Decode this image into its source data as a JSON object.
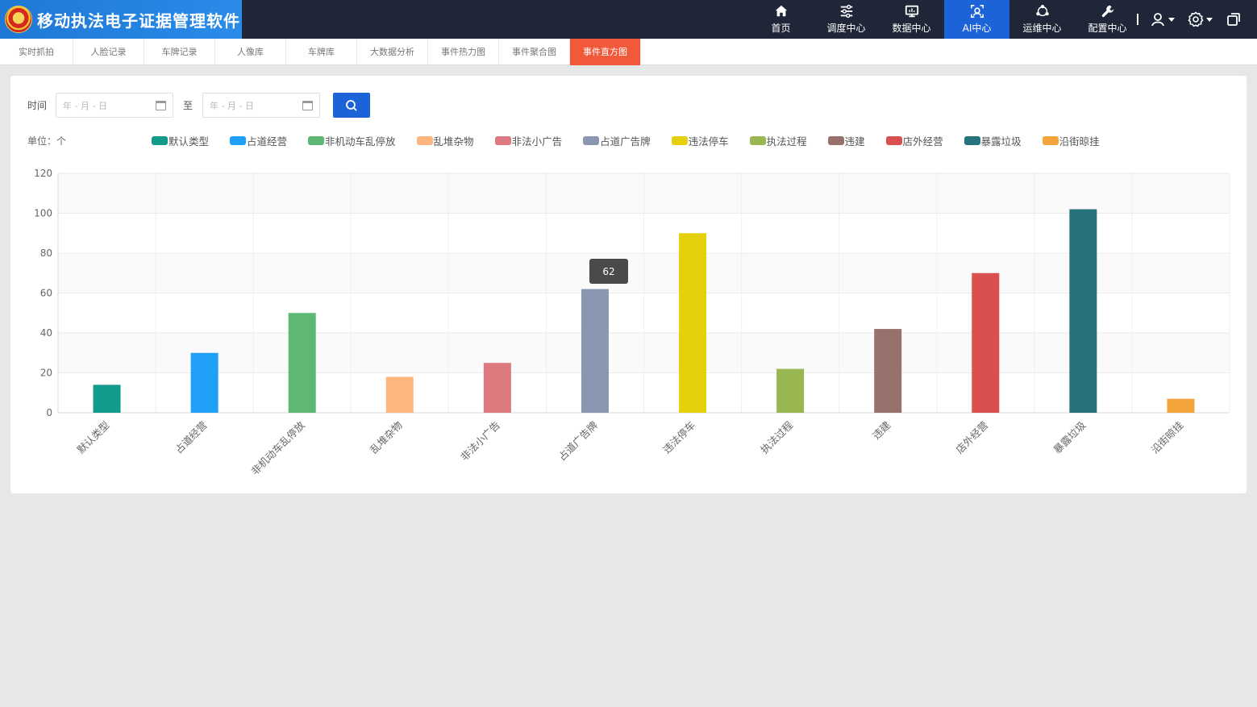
{
  "app": {
    "title": "移动执法电子证据管理软件"
  },
  "nav": [
    {
      "label": "首页",
      "icon": "home-icon",
      "active": false
    },
    {
      "label": "调度中心",
      "icon": "sliders-icon",
      "active": false
    },
    {
      "label": "数据中心",
      "icon": "monitor-icon",
      "active": false
    },
    {
      "label": "AI中心",
      "icon": "ai-face-icon",
      "active": true
    },
    {
      "label": "运维中心",
      "icon": "network-icon",
      "active": false
    },
    {
      "label": "配置中心",
      "icon": "wrench-icon",
      "active": false
    }
  ],
  "tabs": [
    {
      "label": "实时抓拍",
      "active": false
    },
    {
      "label": "人脸记录",
      "active": false
    },
    {
      "label": "车牌记录",
      "active": false
    },
    {
      "label": "人像库",
      "active": false
    },
    {
      "label": "车牌库",
      "active": false
    },
    {
      "label": "大数据分析",
      "active": false
    },
    {
      "label": "事件热力图",
      "active": false
    },
    {
      "label": "事件聚合图",
      "active": false
    },
    {
      "label": "事件直方图",
      "active": true
    }
  ],
  "filter": {
    "time_label": "时间",
    "to_label": "至",
    "start_placeholder": "年 - 月 - 日",
    "end_placeholder": "年 - 月 - 日"
  },
  "unit_label": "单位：个",
  "tooltip": {
    "value": "62"
  },
  "chart_data": {
    "type": "bar",
    "categories": [
      "默认类型",
      "占道经营",
      "非机动车乱停放",
      "乱堆杂物",
      "非法小广告",
      "占道广告牌",
      "违法停车",
      "执法过程",
      "违建",
      "店外经营",
      "暴露垃圾",
      "沿街晾挂"
    ],
    "values": [
      14,
      30,
      50,
      18,
      25,
      62,
      90,
      22,
      42,
      70,
      102,
      7
    ],
    "colors": [
      "#129a8a",
      "#1f9ff8",
      "#5eb874",
      "#feb67e",
      "#dc7a80",
      "#8b97b1",
      "#e5d00e",
      "#99b750",
      "#98706c",
      "#d9504e",
      "#26727d",
      "#f3a43b"
    ],
    "ylim": [
      0,
      120
    ],
    "yticks": [
      0,
      20,
      40,
      60,
      80,
      100,
      120
    ],
    "grid": true,
    "legend": "top"
  }
}
